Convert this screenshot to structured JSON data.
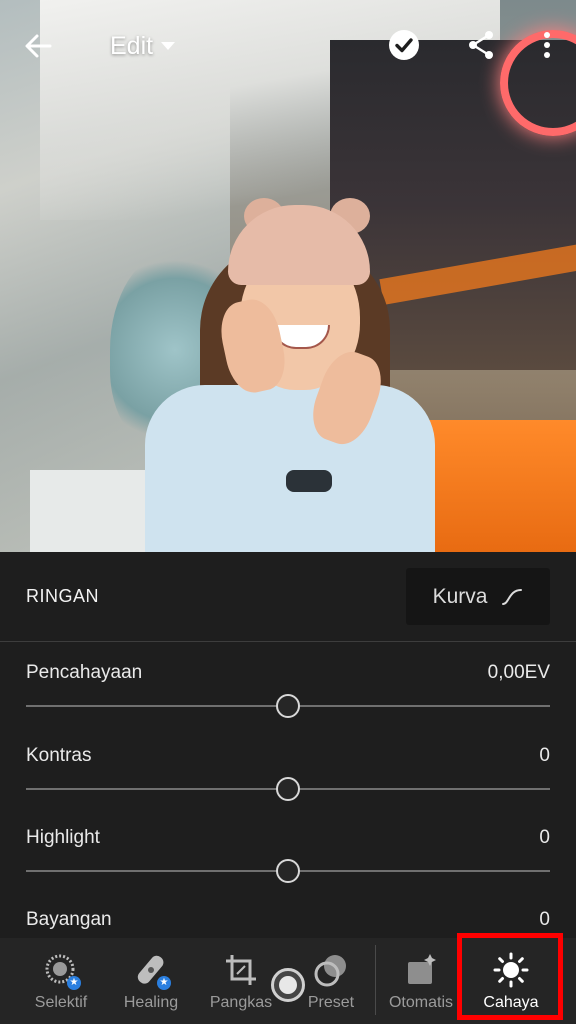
{
  "header": {
    "title": "Edit"
  },
  "panel": {
    "title": "RINGAN",
    "curve_button_label": "Kurva",
    "sliders": [
      {
        "label": "Pencahayaan",
        "value": "0,00EV",
        "position": 0.5
      },
      {
        "label": "Kontras",
        "value": "0",
        "position": 0.5
      },
      {
        "label": "Highlight",
        "value": "0",
        "position": 0.5
      },
      {
        "label": "Bayangan",
        "value": "0",
        "position": 0.5
      }
    ]
  },
  "toolbar": {
    "tools": [
      {
        "label": "Selektif",
        "icon": "selective-icon"
      },
      {
        "label": "Healing",
        "icon": "healing-icon"
      },
      {
        "label": "Pangkas",
        "icon": "crop-icon"
      },
      {
        "label": "Preset",
        "icon": "preset-icon"
      },
      {
        "label": "Otomatis",
        "icon": "auto-icon"
      },
      {
        "label": "Cahaya",
        "icon": "sun-icon",
        "active": true
      }
    ]
  },
  "colors": {
    "panel_bg": "#1e1e1e",
    "highlight_box": "#ff0000",
    "badge_blue": "#2a7fe0"
  }
}
